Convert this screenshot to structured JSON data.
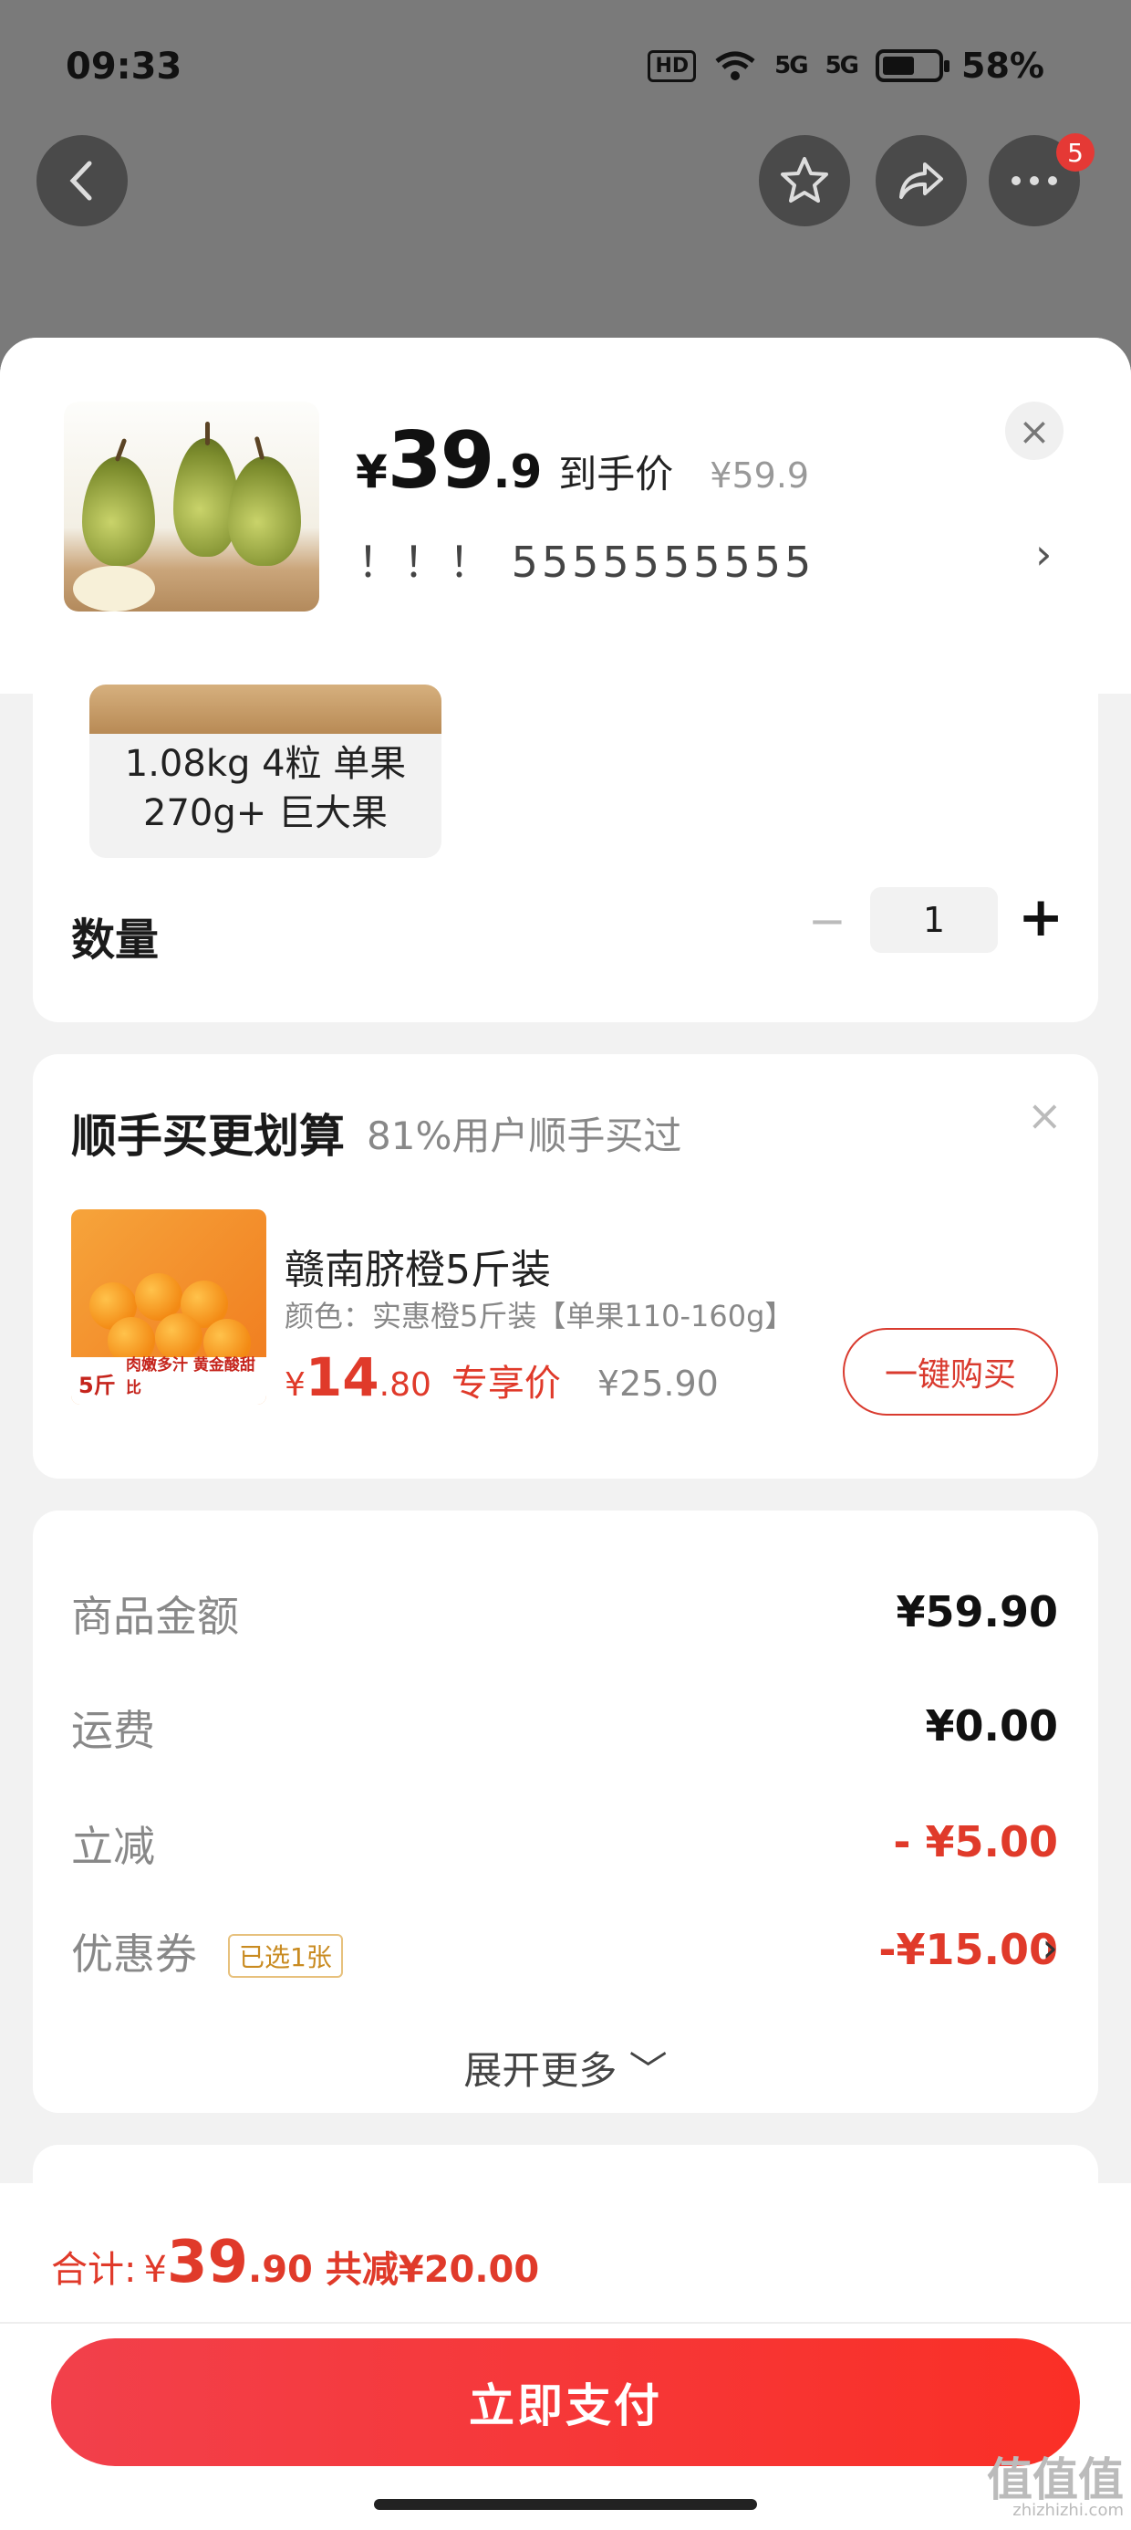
{
  "status_bar": {
    "time": "09:33",
    "hd": "HD",
    "sig1": "5G",
    "sig2": "5G",
    "battery": "58%",
    "battery_level": 0.58
  },
  "top_nav": {
    "back_icon": "chevron-left-icon",
    "favorite_icon": "star-icon",
    "share_icon": "share-icon",
    "more_icon": "more-icon",
    "more_badge": "5"
  },
  "product": {
    "price_yen": "¥",
    "price_int": "39",
    "price_dec": ".9",
    "price_label": "到手价",
    "original_price": "¥59.9",
    "sku_text": "！！！ 5555555555",
    "sku_arrow": "›",
    "close": "×"
  },
  "options": {
    "selected_option": "1.08kg 4粒 单果 270g+ 巨大果",
    "quantity_label": "数量",
    "quantity_minus": "−",
    "quantity_value": "1",
    "quantity_plus": "+"
  },
  "upsell": {
    "title": "顺手买更划算",
    "subtitle": "81%用户顺手买过",
    "close": "×",
    "image_badge": "5斤",
    "image_caption": "肉嫩多汁 黄金酸甜比",
    "item_name": "赣南脐橙5斤装",
    "item_spec": "颜色：实惠橙5斤装【单果110-160g】",
    "price_yen": "¥",
    "price_int": "14",
    "price_dec": ".80",
    "price_label": "专享价",
    "original_price": "¥25.90",
    "buy_button": "一键购买"
  },
  "summary": {
    "rows": [
      {
        "label": "商品金额",
        "value": "¥59.90"
      },
      {
        "label": "运费",
        "value": "¥0.00"
      },
      {
        "label": "立减",
        "value": "- ¥5.00"
      },
      {
        "label": "优惠券",
        "value": "-¥15.00"
      }
    ],
    "coupon_tag": "已选1张",
    "coupon_arrow": "›",
    "expand": "展开更多 ﹀"
  },
  "footer": {
    "total_label": "合计:",
    "total_yen": "¥",
    "total_int": "39",
    "total_dec": ".90",
    "total_saving": "共减¥20.00",
    "pay_button": "立即支付",
    "watermark": "值值值",
    "watermark_url": "zhizhizhi.com"
  },
  "colors": {
    "accent_red": "#e03a2a",
    "pay_button": "#fa2f26",
    "coupon_tag": "#c98b21"
  }
}
